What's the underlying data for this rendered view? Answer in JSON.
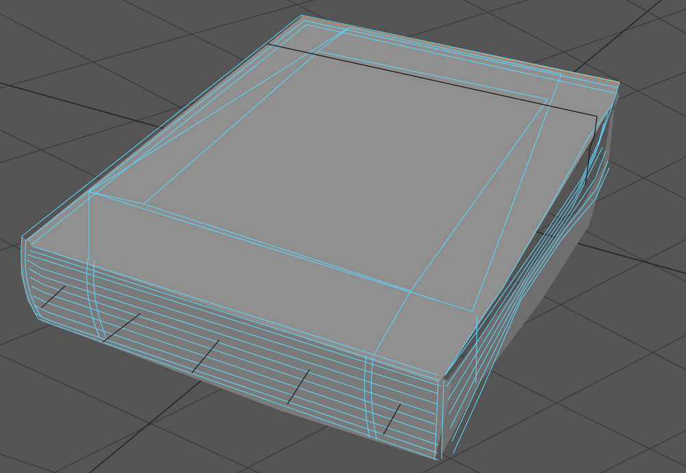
{
  "viewport": {
    "background_color": "#545454",
    "grid_color": "#3a3a3a",
    "grid_major_color": "#2b2b2b"
  },
  "model": {
    "object_type": "book",
    "display_mode": "shaded-with-wireframe",
    "selected": true,
    "surface_color": "#8f8f8f",
    "side_color": "#6f6f6f",
    "wireframe_color": "#5fd3f3",
    "highlight_edge_color": "#e8a060",
    "edge_color": "#1a1a1a"
  }
}
